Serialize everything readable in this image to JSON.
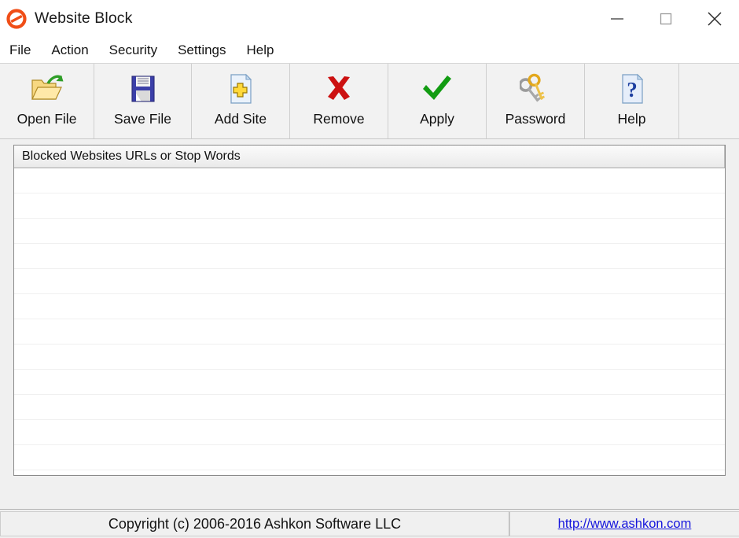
{
  "window": {
    "title": "Website Block",
    "icon": "prohibition-sign-icon",
    "controls": {
      "minimize": "minimize-icon",
      "maximize": "maximize-icon",
      "close": "close-icon"
    }
  },
  "menubar": {
    "items": [
      {
        "label": "File"
      },
      {
        "label": "Action"
      },
      {
        "label": "Security"
      },
      {
        "label": "Settings"
      },
      {
        "label": "Help"
      }
    ]
  },
  "toolbar": {
    "buttons": [
      {
        "label": "Open File",
        "icon": "open-folder-icon"
      },
      {
        "label": "Save File",
        "icon": "floppy-disk-icon"
      },
      {
        "label": "Add Site",
        "icon": "document-plus-icon"
      },
      {
        "label": "Remove",
        "icon": "red-x-icon"
      },
      {
        "label": "Apply",
        "icon": "green-check-icon"
      },
      {
        "label": "Password",
        "icon": "keys-icon"
      },
      {
        "label": "Help",
        "icon": "document-question-icon"
      }
    ]
  },
  "list": {
    "columns": [
      {
        "header": "Blocked Websites URLs or Stop Words"
      }
    ],
    "rows": [],
    "row_count": 12
  },
  "statusbar": {
    "copyright": "Copyright (c) 2006-2016 Ashkon Software LLC",
    "link": "http://www.ashkon.com"
  },
  "colors": {
    "accent_orange": "#f04e17",
    "link_blue": "#1515dd",
    "toolbar_bg": "#f2f2f2",
    "window_bg": "#f0f0f0"
  }
}
